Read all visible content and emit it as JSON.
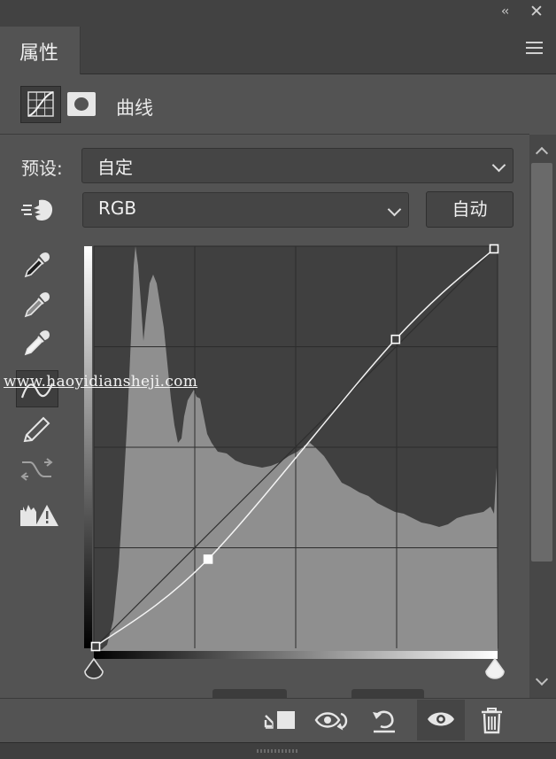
{
  "window": {
    "collapse_glyph": "‹‹",
    "close_glyph": "✕"
  },
  "tab": {
    "title": "属性"
  },
  "header": {
    "title": "曲线",
    "icons": [
      "curves-adjustment-icon",
      "layer-mask-icon"
    ]
  },
  "preset": {
    "label": "预设:",
    "value": "自定"
  },
  "channel": {
    "value": "RGB",
    "auto_label": "自动"
  },
  "tools": [
    "on-image-adjust-icon",
    "black-point-eyedropper-icon",
    "gray-point-eyedropper-icon",
    "white-point-eyedropper-icon",
    "curve-edit-points-icon",
    "pencil-icon",
    "smooth-curve-icon",
    "clipping-warning-icon"
  ],
  "watermark": "www.haoyidiansheji.com",
  "curve": {
    "input_range": [
      0,
      255
    ],
    "output_range": [
      0,
      255
    ],
    "points": [
      [
        0,
        0
      ],
      [
        72,
        56
      ],
      [
        192,
        197
      ],
      [
        255,
        255
      ]
    ]
  },
  "bottom_icons": [
    "clip-to-layer-icon",
    "view-previous-state-icon",
    "reset-icon",
    "visibility-eye-icon",
    "trash-icon"
  ],
  "colors": {
    "panel_bg": "#535353",
    "graph_bg": "#404040",
    "histogram": "#8f8f8f"
  }
}
